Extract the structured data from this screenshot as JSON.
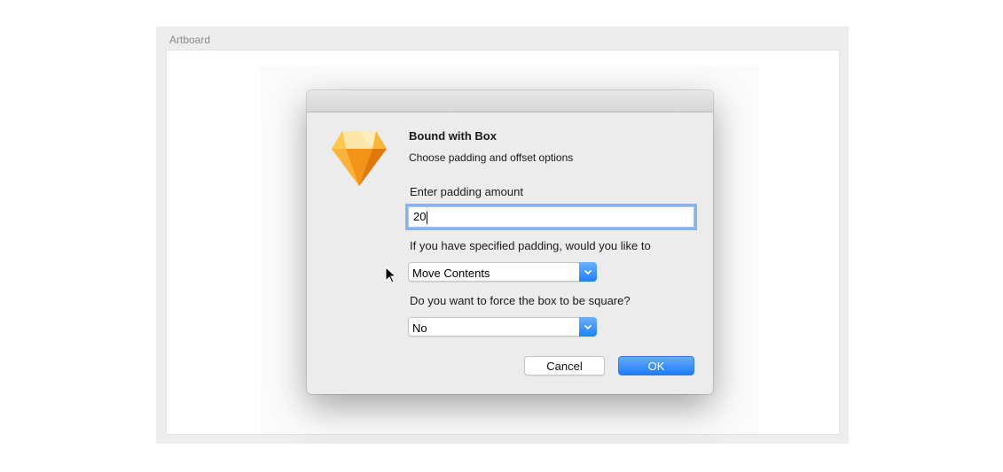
{
  "artboard": {
    "label": "Artboard"
  },
  "dialog": {
    "title": "Bound with Box",
    "subtitle": "Choose padding and offset options",
    "app_icon": "sketch-diamond-icon",
    "padding_label": "Enter padding amount",
    "padding_value": "20",
    "move_label": "If you have specified padding, would you like to",
    "move_selected": "Move Contents",
    "square_label": "Do you want to force the box to be square?",
    "square_selected": "No",
    "cancel_label": "Cancel",
    "ok_label": "OK"
  },
  "colors": {
    "accent": "#1f7ff5",
    "focus_ring": "#86b3f0",
    "icon_orange": "#f7a021"
  }
}
